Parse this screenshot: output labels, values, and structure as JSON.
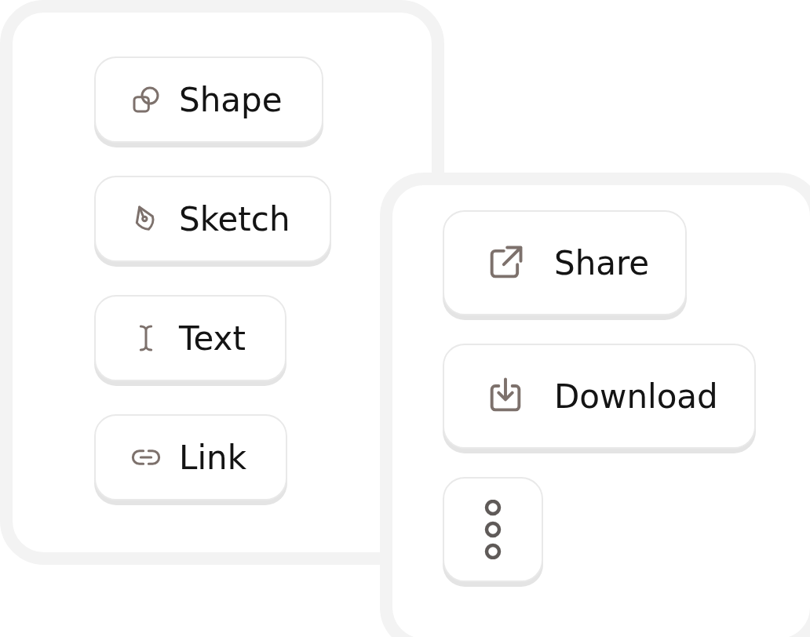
{
  "left_panel": {
    "buttons": [
      {
        "kind": "shape",
        "label": "Shape"
      },
      {
        "kind": "sketch",
        "label": "Sketch"
      },
      {
        "kind": "text",
        "label": "Text"
      },
      {
        "kind": "link",
        "label": "Link"
      }
    ]
  },
  "right_panel": {
    "buttons": [
      {
        "kind": "share",
        "label": "Share"
      },
      {
        "kind": "download",
        "label": "Download"
      },
      {
        "kind": "more"
      }
    ]
  }
}
